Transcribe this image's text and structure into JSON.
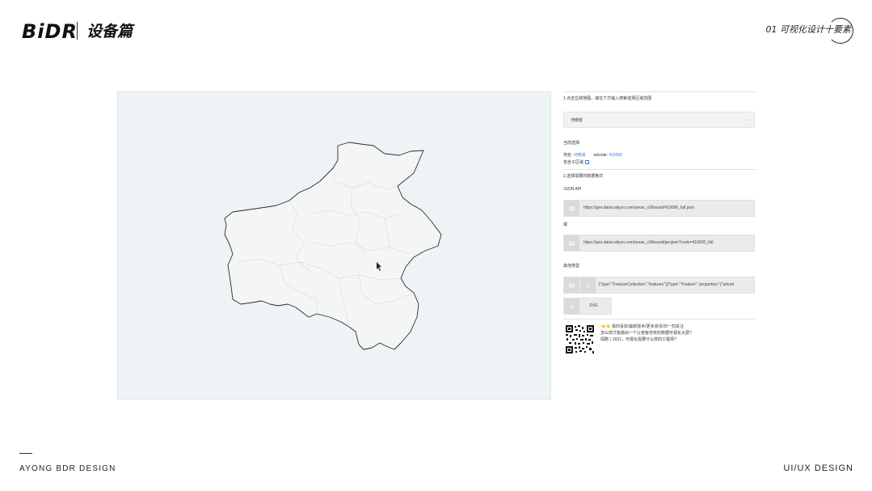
{
  "header": {
    "brand": "BiDR",
    "subtitle": "设备篇",
    "chapter": "01 可视化设计十要素"
  },
  "footer": {
    "left": "AYONG BDR DESIGN",
    "right": "UI/UX DESIGN"
  },
  "panel": {
    "step1": "1.点击左侧地图，或在下方输入搜索选择区域范围",
    "region_select": {
      "value": "河南省",
      "chevron_icon": "chevron-down-icon"
    },
    "current_label": "当前选择:",
    "name_label": "地名:",
    "name_value": "河南省",
    "adcode_label": "adcode:",
    "adcode_value": "410000",
    "subregion_label": "包含子区域",
    "step2": "2.选择需要的数据格式",
    "json_api_label": "JSON API",
    "url1": "https://geo.datav.aliyun.com/areas_v3/bound/410000_full.json",
    "or_label": "或",
    "url2": "https://geo.datav.aliyun.com/areas_v3/bound/geojson?code=410000_full",
    "other_label": "其他类型",
    "geojson_preview": "{\"type\":\"FeatureCollection\",\"features\":[{\"type\":\"Feature\",\"properties\":{\"adcod",
    "svg_label": "SVG",
    "promo1": "👈👈 猜你喜欢/最新技术/更多资讯/扫一扫关注",
    "promo2": "怎么样才能做出一个让老板夸奖的数据可视化大屏?",
    "promo3": "招聘丨2021，可视化需要什么样的工程师?"
  },
  "icons": {
    "copy": "copy-icon",
    "download": "download-icon",
    "cursor": "cursor-icon",
    "qr": "qr-code-icon"
  },
  "colors": {
    "map_bg": "#eef3f5",
    "region_fill": "#f4f6f6",
    "accent": "#3a78d0"
  }
}
